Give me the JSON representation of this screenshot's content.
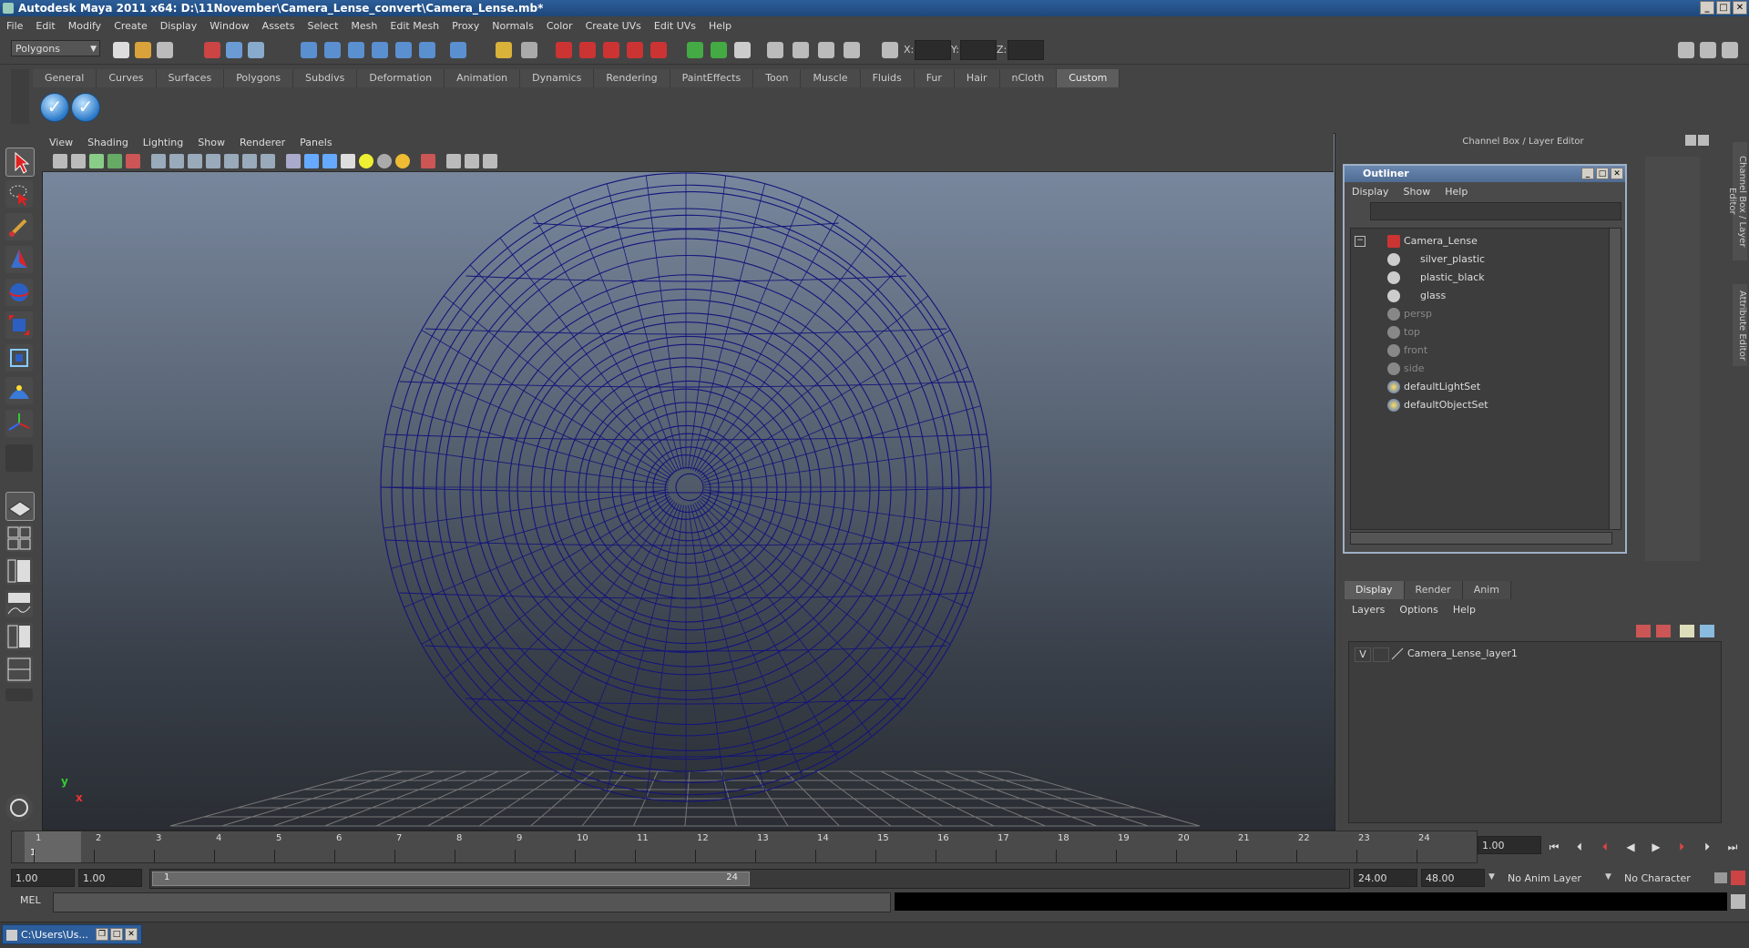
{
  "window": {
    "title": "Autodesk Maya 2011 x64: D:\\11November\\Camera_Lense_convert\\Camera_Lense.mb*"
  },
  "menubar": [
    "File",
    "Edit",
    "Modify",
    "Create",
    "Display",
    "Window",
    "Assets",
    "Select",
    "Mesh",
    "Edit Mesh",
    "Proxy",
    "Normals",
    "Color",
    "Create UVs",
    "Edit UVs",
    "Help"
  ],
  "statusline": {
    "mode": "Polygons",
    "x_label": "X:",
    "y_label": "Y:",
    "z_label": "Z:"
  },
  "shelf": {
    "tabs": [
      "General",
      "Curves",
      "Surfaces",
      "Polygons",
      "Subdivs",
      "Deformation",
      "Animation",
      "Dynamics",
      "Rendering",
      "PaintEffects",
      "Toon",
      "Muscle",
      "Fluids",
      "Fur",
      "Hair",
      "nCloth",
      "Custom"
    ],
    "active_tab": "Custom"
  },
  "viewport": {
    "menu": [
      "View",
      "Shading",
      "Lighting",
      "Show",
      "Renderer",
      "Panels"
    ],
    "axis_y": "y",
    "axis_x": "x",
    "wire_color": "#14147a"
  },
  "channel_box_label": "Channel Box / Layer Editor",
  "outliner": {
    "title": "Outliner",
    "menu": [
      "Display",
      "Show",
      "Help"
    ],
    "items": [
      {
        "label": "Camera_Lense",
        "level": 0,
        "dim": false,
        "icon": "group-icon"
      },
      {
        "label": "silver_plastic",
        "level": 1,
        "dim": false,
        "icon": "mesh-icon"
      },
      {
        "label": "plastic_black",
        "level": 1,
        "dim": false,
        "icon": "mesh-icon"
      },
      {
        "label": "glass",
        "level": 1,
        "dim": false,
        "icon": "mesh-icon"
      },
      {
        "label": "persp",
        "level": 0,
        "dim": true,
        "icon": "camera-icon"
      },
      {
        "label": "top",
        "level": 0,
        "dim": true,
        "icon": "camera-icon"
      },
      {
        "label": "front",
        "level": 0,
        "dim": true,
        "icon": "camera-icon"
      },
      {
        "label": "side",
        "level": 0,
        "dim": true,
        "icon": "camera-icon"
      },
      {
        "label": "defaultLightSet",
        "level": 0,
        "dim": false,
        "icon": "set-icon"
      },
      {
        "label": "defaultObjectSet",
        "level": 0,
        "dim": false,
        "icon": "set-icon"
      }
    ]
  },
  "layer_editor": {
    "tabs": [
      "Display",
      "Render",
      "Anim"
    ],
    "active_tab": "Display",
    "menu": [
      "Layers",
      "Options",
      "Help"
    ],
    "layers": [
      {
        "visible": "V",
        "name": "Camera_Lense_layer1"
      }
    ]
  },
  "vertical_tabs": [
    "Channel Box / Layer Editor",
    "Attribute Editor"
  ],
  "timeline": {
    "frames": [
      "1",
      "2",
      "3",
      "4",
      "5",
      "6",
      "7",
      "8",
      "9",
      "10",
      "11",
      "12",
      "13",
      "14",
      "15",
      "16",
      "17",
      "18",
      "19",
      "20",
      "21",
      "22",
      "23",
      "24"
    ],
    "current_frame": "1.00",
    "current_marker": "1"
  },
  "range": {
    "start": "1.00",
    "playback_start": "1.00",
    "bar_start": "1",
    "bar_end": "24",
    "playback_end": "24.00",
    "end": "48.00",
    "anim_layer": "No Anim Layer",
    "character_set": "No Character Set"
  },
  "cmdline": {
    "label": "MEL"
  },
  "taskbar": {
    "item": "C:\\Users\\Us..."
  }
}
